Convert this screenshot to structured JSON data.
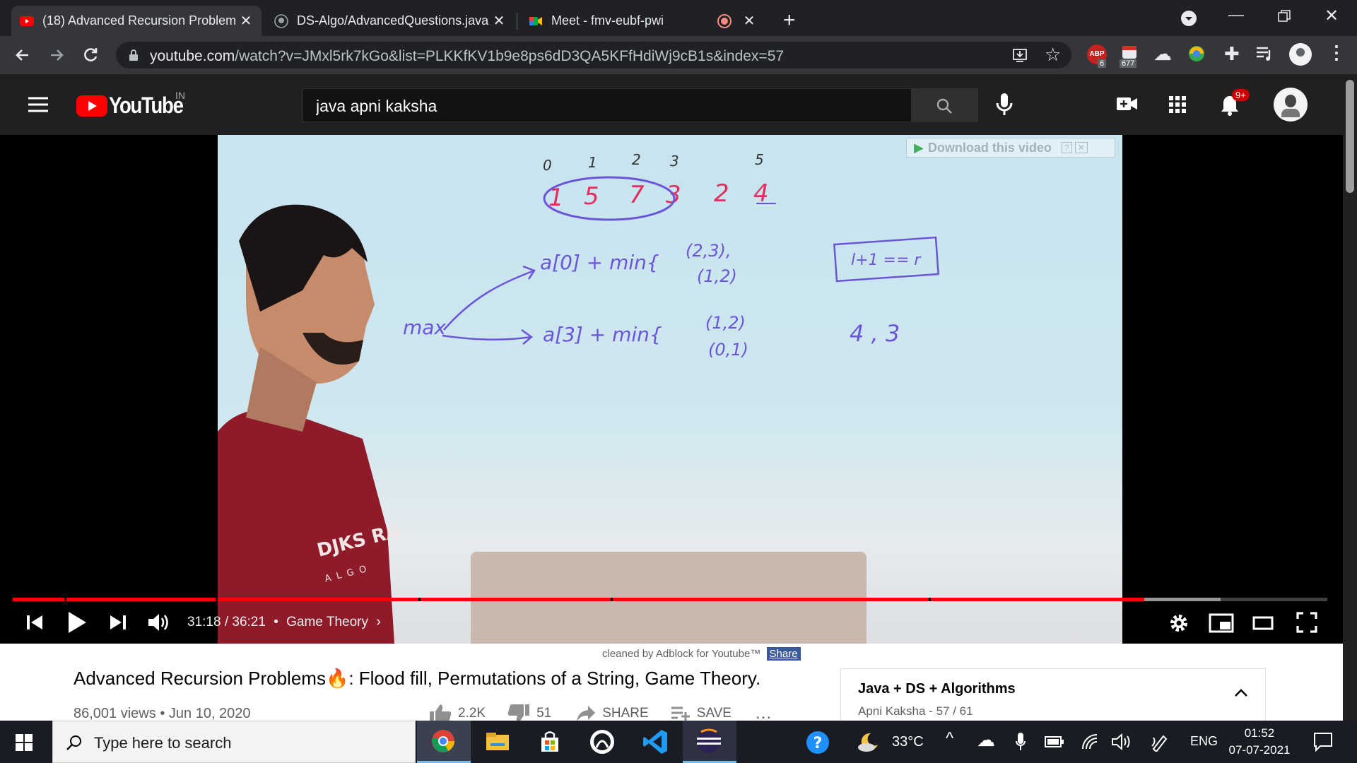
{
  "browser": {
    "tabs": [
      {
        "title": "(18) Advanced Recursion Problem",
        "active": true
      },
      {
        "title": "DS-Algo/AdvancedQuestions.java",
        "active": false
      },
      {
        "title": "Meet - fmv-eubf-pwi",
        "active": false
      }
    ],
    "url_host": "youtube.com",
    "url_path": "/watch?v=JMxl5rk7kGo&list=PLKKfKV1b9e8ps6dD3QA5KFfHdiWj9cB1s&index=57",
    "ext_badge_abp": "6",
    "ext_badge_count": "677",
    "ext_abp_label": "ABP"
  },
  "youtube": {
    "logo_text": "YouTube",
    "country": "IN",
    "search_value": "java apni kaksha",
    "notif_badge": "9+"
  },
  "player": {
    "time": "31:18 / 36:21",
    "chapter": "Game Theory",
    "chapter_sep": "•",
    "progress_played": 0.861,
    "progress_buffered": 0.919,
    "download_label": "Download this video",
    "download_help": "?",
    "whiteboard": {
      "indices": [
        "0",
        "1",
        "2",
        "3",
        "5"
      ],
      "array": [
        "1",
        "5",
        "7",
        "3",
        "2",
        "4"
      ],
      "line1": "a[0] + min{",
      "line1_pairs": [
        "(2,3),",
        "(1,2)"
      ],
      "line2": "a[3] + min{",
      "line2_pairs": [
        "(1,2)",
        "(0,1)"
      ],
      "max_label": "max",
      "box_text": "l+1 == r",
      "pair_text": "4 , 3"
    },
    "shirt_text": "DJKS RA",
    "shirt_sub": "ALGO"
  },
  "adblock": {
    "text": "cleaned by Adblock for Youtube™",
    "share": "Share"
  },
  "video_info": {
    "title": "Advanced Recursion Problems🔥: Flood fill, Permutations of a String, Game Theory.",
    "views": "86,001 views",
    "sep": "•",
    "date": "Jun 10, 2020",
    "likes": "2.2K",
    "dislikes": "51",
    "share": "SHARE",
    "save": "SAVE",
    "more": "..."
  },
  "playlist": {
    "title": "Java + DS + Algorithms",
    "channel": "Apni Kaksha",
    "position": "57 / 61",
    "sep": "-"
  },
  "taskbar": {
    "search_placeholder": "Type here to search",
    "temp": "33°C",
    "lang": "ENG",
    "time": "01:52",
    "date": "07-07-2021"
  },
  "colors": {
    "yt_red": "#ff0000",
    "chrome_dark": "#202124",
    "taskbar": "#1a1c24"
  }
}
